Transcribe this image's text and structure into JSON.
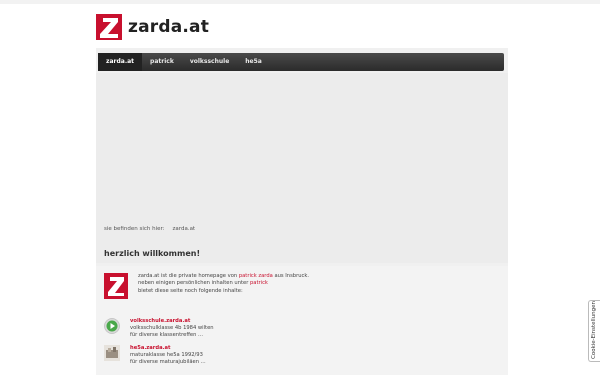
{
  "header": {
    "title": "zarda.at"
  },
  "nav": {
    "items": [
      "zarda.at",
      "patrick",
      "volksschule",
      "he5a"
    ]
  },
  "breadcrumb": {
    "label": "sie befinden sich hier:",
    "current": "zarda.at"
  },
  "main": {
    "heading": "herzlich willkommen!",
    "intro_line1_a": "zarda.at ist die private homepage von ",
    "intro_line1_link": "patrick zarda",
    "intro_line1_b": " aus Insbruck.",
    "intro_line2_a": "neben einigen persönlichen inhalten unter ",
    "intro_line2_link": "patrick",
    "intro_line3": "bietet diese seite noch folgende inhalte:",
    "items": [
      {
        "title": "volksschule.zarda.at",
        "line1": "volksschulklasse 4b 1984 wilten",
        "line2": "für diverse klassentreffen ..."
      },
      {
        "title": "he5a.zarda.at",
        "line1": "maturaklasse he5a 1992/93",
        "line2": "für diverse maturajubiläen ..."
      }
    ]
  },
  "cookie": {
    "label": "Cookie-Einstellungen"
  },
  "colors": {
    "brand": "#c8102e",
    "nav_bg": "#333333"
  }
}
